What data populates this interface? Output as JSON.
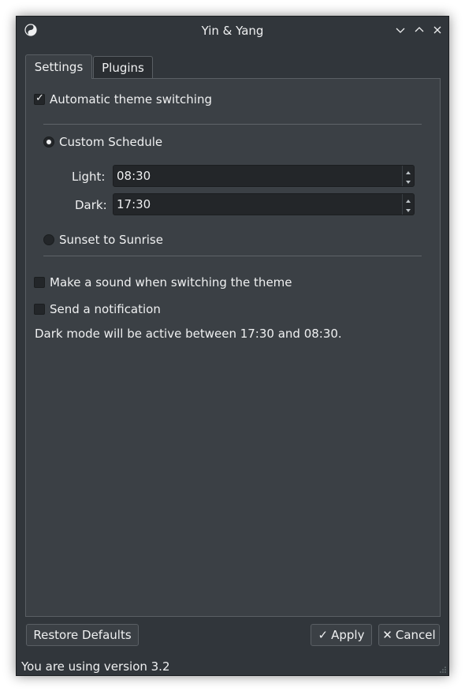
{
  "window": {
    "title": "Yin & Yang"
  },
  "titlebar_buttons": {
    "minimize": "minimize-icon",
    "maximize": "maximize-icon",
    "close": "close-icon"
  },
  "tabs": [
    {
      "label": "Settings",
      "active": true
    },
    {
      "label": "Plugins",
      "active": false
    }
  ],
  "settings": {
    "auto_switch": {
      "label": "Automatic theme switching",
      "checked": true
    },
    "custom_schedule": {
      "label": "Custom Schedule",
      "selected": true
    },
    "light": {
      "label": "Light:",
      "value": "08:30"
    },
    "dark": {
      "label": "Dark:",
      "value": "17:30"
    },
    "sunset": {
      "label": "Sunset to Sunrise",
      "selected": false
    },
    "sound": {
      "label": "Make a sound when switching the theme",
      "checked": false
    },
    "notification": {
      "label": "Send a notification",
      "checked": false
    },
    "info_text": "Dark mode will be active between 17:30 and 08:30."
  },
  "buttons": {
    "restore_defaults": "Restore Defaults",
    "apply": "Apply",
    "cancel": "Cancel"
  },
  "status": "You are using version 3.2",
  "colors": {
    "window_bg": "#31363b",
    "panel_bg": "#3b4045",
    "field_bg": "#232629",
    "text": "#eff0f1"
  }
}
